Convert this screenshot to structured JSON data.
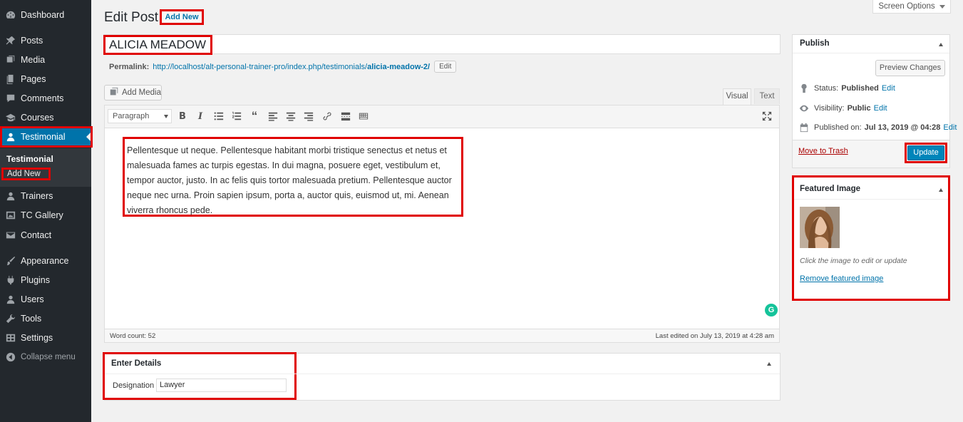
{
  "sidebar": {
    "items": [
      {
        "label": "Dashboard",
        "icon": "dashboard-icon"
      },
      {
        "label": "Posts",
        "icon": "pin-icon"
      },
      {
        "label": "Media",
        "icon": "media-icon"
      },
      {
        "label": "Pages",
        "icon": "pages-icon"
      },
      {
        "label": "Comments",
        "icon": "comments-icon"
      },
      {
        "label": "Courses",
        "icon": "courses-icon"
      },
      {
        "label": "Testimonial",
        "icon": "user-icon"
      },
      {
        "label": "Trainers",
        "icon": "user-icon"
      },
      {
        "label": "TC Gallery",
        "icon": "gallery-icon"
      },
      {
        "label": "Contact",
        "icon": "mail-icon"
      },
      {
        "label": "Appearance",
        "icon": "brush-icon"
      },
      {
        "label": "Plugins",
        "icon": "plugin-icon"
      },
      {
        "label": "Users",
        "icon": "users-icon"
      },
      {
        "label": "Tools",
        "icon": "wrench-icon"
      },
      {
        "label": "Settings",
        "icon": "settings-icon"
      },
      {
        "label": "Collapse menu",
        "icon": "collapse-icon"
      }
    ],
    "submenu": {
      "title": "Testimonial",
      "add_new": "Add New"
    }
  },
  "header": {
    "title": "Edit Post",
    "add_new": "Add New",
    "screen_options": "Screen Options"
  },
  "post": {
    "title": "ALICIA MEADOW",
    "permalink_label": "Permalink:",
    "permalink_base": "http://localhost/alt-personal-trainer-pro/index.php/testimonials/",
    "permalink_slug": "alicia-meadow-2/",
    "permalink_edit": "Edit",
    "content": "Pellentesque ut neque. Pellentesque habitant morbi tristique senectus et netus et malesuada fames ac turpis egestas. In dui magna, posuere eget, vestibulum et, tempor auctor, justo. In ac felis quis tortor malesuada pretium. Pellentesque auctor neque nec urna. Proin sapien ipsum, porta a, auctor quis, euismod ut, mi. Aenean viverra rhoncus pede."
  },
  "editor": {
    "add_media": "Add Media",
    "tab_visual": "Visual",
    "tab_text": "Text",
    "format": "Paragraph",
    "word_count": "Word count: 52",
    "last_edited": "Last edited on July 13, 2019 at 4:28 am",
    "grammarly": "G"
  },
  "details": {
    "title": "Enter Details",
    "designation_label": "Designation",
    "designation_value": "Lawyer"
  },
  "publish": {
    "title": "Publish",
    "preview": "Preview Changes",
    "status_label": "Status:",
    "status_value": "Published",
    "visibility_label": "Visibility:",
    "visibility_value": "Public",
    "published_label": "Published on:",
    "published_value": "Jul 13, 2019 @ 04:28",
    "edit": "Edit",
    "trash": "Move to Trash",
    "update": "Update"
  },
  "featured": {
    "title": "Featured Image",
    "hint": "Click the image to edit or update",
    "remove": "Remove featured image"
  }
}
